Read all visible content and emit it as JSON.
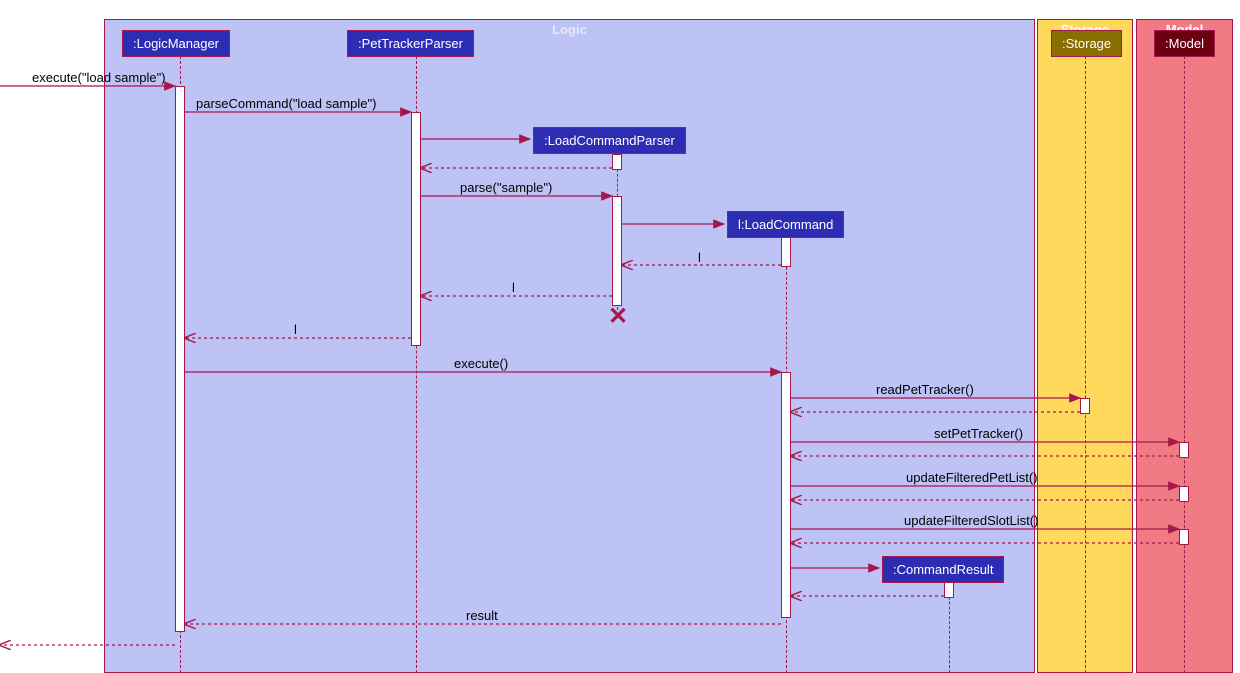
{
  "frames": {
    "logic": "Logic",
    "storage": "Storage",
    "model": "Model"
  },
  "participants": {
    "logicManager": ":LogicManager",
    "petTrackerParser": ":PetTrackerParser",
    "loadCommandParser": ":LoadCommandParser",
    "loadCommand": "l:LoadCommand",
    "commandResult": ":CommandResult",
    "storage": ":Storage",
    "model": ":Model"
  },
  "messages": {
    "execute_load_sample": "execute(\"load sample\")",
    "parseCommand": "parseCommand(\"load sample\")",
    "parse_sample": "parse(\"sample\")",
    "ret_l1": "l",
    "ret_l2": "l",
    "ret_l3": "l",
    "execute": "execute()",
    "readPetTracker": "readPetTracker()",
    "setPetTracker": "setPetTracker()",
    "updateFilteredPetList": "updateFilteredPetList()",
    "updateFilteredSlotList": "updateFilteredSlotList()",
    "result": "result"
  },
  "colors": {
    "accent": "#a6174d",
    "logic_bg": "#bdc3f4",
    "storage_bg": "#ffd95c",
    "model_bg": "#f07b85",
    "participant_blue": "#2d2db3",
    "participant_gold": "#8a6d00",
    "participant_maroon": "#6b0011"
  }
}
